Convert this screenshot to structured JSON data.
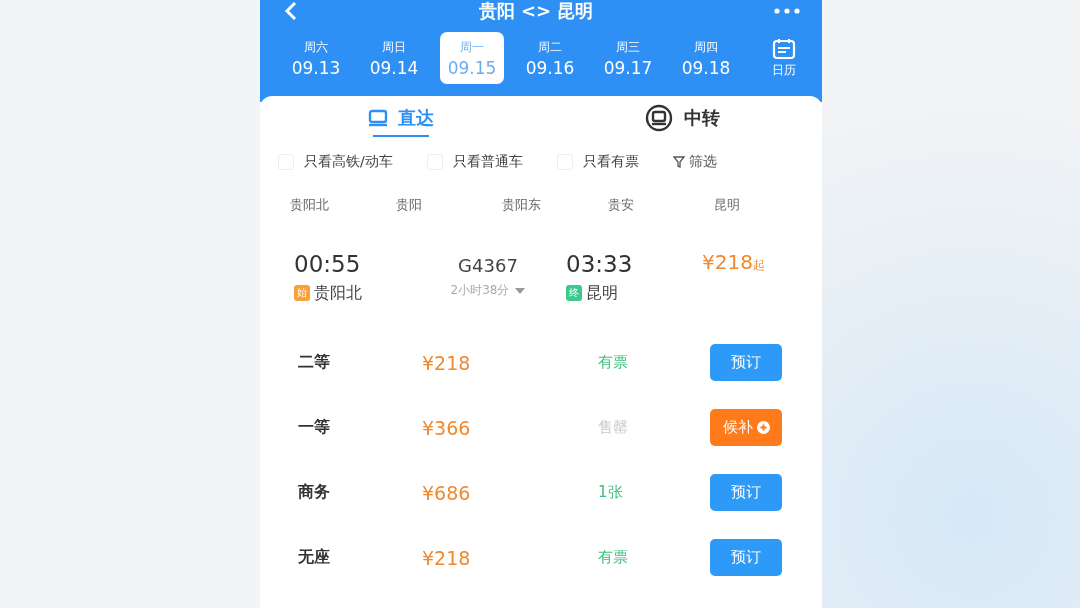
{
  "header": {
    "title": "贵阳 <> 昆明",
    "calendar_label": "日历"
  },
  "dates": [
    {
      "weekday": "周六",
      "date": "09.13",
      "selected": false
    },
    {
      "weekday": "周日",
      "date": "09.14",
      "selected": false
    },
    {
      "weekday": "周一",
      "date": "09.15",
      "selected": true
    },
    {
      "weekday": "周二",
      "date": "09.16",
      "selected": false
    },
    {
      "weekday": "周三",
      "date": "09.17",
      "selected": false
    },
    {
      "weekday": "周四",
      "date": "09.18",
      "selected": false
    }
  ],
  "modes": [
    {
      "label": "直达",
      "selected": true
    },
    {
      "label": "中转",
      "selected": false
    }
  ],
  "filters": [
    {
      "label": "只看高铁/动车",
      "checked": false
    },
    {
      "label": "只看普通车",
      "checked": false
    },
    {
      "label": "只看有票",
      "checked": false
    }
  ],
  "filter_button": "筛选",
  "stations": [
    "贵阳北",
    "贵阳",
    "贵阳东",
    "贵安",
    "昆明"
  ],
  "train": {
    "depart_time": "00:55",
    "depart_badge": "始",
    "depart_station": "贵阳北",
    "number": "G4367",
    "duration": "2小时38分",
    "arrive_time": "03:33",
    "arrive_badge": "终",
    "arrive_station": "昆明",
    "price": "¥218",
    "price_suffix": "起"
  },
  "seats": [
    {
      "class": "二等",
      "price": "¥218",
      "status": "有票",
      "kind": "available",
      "action": {
        "label": "预订",
        "kind": "book"
      }
    },
    {
      "class": "一等",
      "price": "¥366",
      "status": "售罄",
      "kind": "soldout",
      "action": {
        "label": "候补",
        "kind": "waitlist"
      }
    },
    {
      "class": "商务",
      "price": "¥686",
      "status": "1张",
      "kind": "available",
      "action": {
        "label": "预订",
        "kind": "book"
      }
    },
    {
      "class": "无座",
      "price": "¥218",
      "status": "有票",
      "kind": "available",
      "action": {
        "label": "预订",
        "kind": "book"
      }
    }
  ]
}
